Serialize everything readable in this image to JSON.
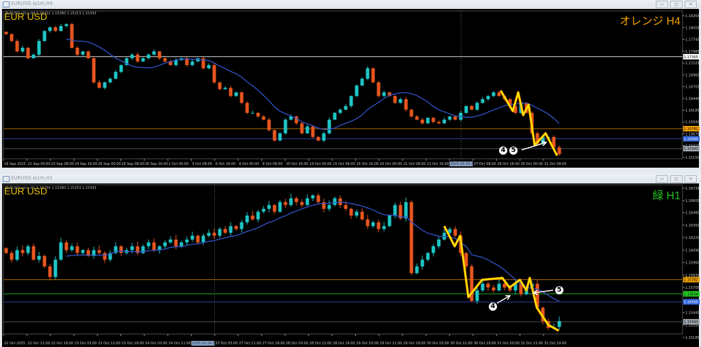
{
  "windows": [
    {
      "title": "EURUSD.oj1m,H4",
      "ohlc_header": "EURUSD.oj1m,H4  1.15301 1.15380 1.15213 1.15343",
      "symbol_label": "EUR USD",
      "timeframe_label": "オレンジ H4",
      "timeframe_color": "#f0a000"
    },
    {
      "title": "EURUSD.oj1m,H1",
      "ohlc_header": "EURUSD.oj1m,H1  1.15254 1.15380 1.15253 1.15343",
      "symbol_label": "EUR USD",
      "timeframe_label": "緑 H1",
      "timeframe_color": "#22c022"
    }
  ],
  "window_buttons": {
    "minimize": "▭",
    "restore": "◫",
    "close": "✕"
  },
  "annotations": {
    "top": [
      "4",
      "5"
    ],
    "bottom": [
      "4",
      "5"
    ]
  },
  "colors": {
    "up": "#1fc6c6",
    "down": "#e8561e",
    "ma": "#3355cc",
    "zigzag": "#ffe800"
  },
  "chart_data": [
    {
      "type": "candlestick",
      "title": "EURUSD.oj1m,H4",
      "ylim": [
        1.1515,
        1.18265
      ],
      "yticks": [
        "1.18265",
        "1.18005",
        "1.17745",
        "1.17485",
        "1.17225",
        "1.16965",
        "1.16705",
        "1.16445",
        "1.16185",
        "1.15930",
        "1.15670",
        "1.15410",
        "1.15150"
      ],
      "xticks": [
        "18 Sep 2025",
        "22 Sep 00:00",
        "23 Sep 08:00",
        "24 Sep 16:00",
        "26 Sep 00:00",
        "29 Sep 08:00",
        "30 Sep 16:00",
        "2 Oct 00:00",
        "3 Oct 08:00",
        "6 Oct 16:00",
        "8 Oct 00:00",
        "9 Oct 08:00",
        "10 Oct 16:00",
        "14 Oct 00:00",
        "15 Oct 08:00",
        "16 Oct 16:00",
        "20 Oct 00:00",
        "21 Oct 08:00",
        "22 Oct 16:00",
        "2025.10.24 23:55",
        "27 Oct 08:00",
        "28 Oct 16:00",
        "30 Oct 00:00",
        "31 Oct 08:00"
      ],
      "highlight_xtick": 19,
      "separator_tick": 19,
      "closes": [
        1.1786,
        1.1771,
        1.1748,
        1.1756,
        1.1733,
        1.1741,
        1.1771,
        1.1793,
        1.1801,
        1.1793,
        1.1804,
        1.1808,
        1.1756,
        1.1741,
        1.1748,
        1.1733,
        1.168,
        1.1668,
        1.168,
        1.1688,
        1.1703,
        1.1718,
        1.1733,
        1.1741,
        1.1726,
        1.1733,
        1.1741,
        1.1748,
        1.1733,
        1.1726,
        1.1718,
        1.1729,
        1.1733,
        1.1718,
        1.1726,
        1.1733,
        1.1711,
        1.1718,
        1.168,
        1.1665,
        1.1668,
        1.165,
        1.1658,
        1.1635,
        1.1613,
        1.1613,
        1.1605,
        1.1598,
        1.1575,
        1.1552,
        1.1568,
        1.1598,
        1.1605,
        1.159,
        1.1568,
        1.1583,
        1.156,
        1.1552,
        1.1568,
        1.1598,
        1.1613,
        1.162,
        1.1628,
        1.165,
        1.1673,
        1.1688,
        1.1711,
        1.168,
        1.165,
        1.1658,
        1.165,
        1.1635,
        1.1643,
        1.162,
        1.1605,
        1.1598,
        1.159,
        1.1602,
        1.1593,
        1.159,
        1.1598,
        1.1605,
        1.1598,
        1.1613,
        1.1628,
        1.162,
        1.1635,
        1.1643,
        1.165,
        1.1658,
        1.165,
        1.1643,
        1.1628,
        1.1613,
        1.1635,
        1.1613,
        1.1568,
        1.1545,
        1.156,
        1.156,
        1.1537,
        1.1522
      ],
      "ma_period": 12,
      "hlines": [
        {
          "price": "1.17365",
          "color": "#e0e0e0",
          "label_bg": "#ffffff",
          "label_fg": "#000000"
        },
        {
          "price": "1.15782",
          "color": "#b07000",
          "label_bg": "#f0a000",
          "label_fg": "#000000"
        },
        {
          "price": "1.15560",
          "color": "#3344aa",
          "label_bg": "#3366dd",
          "label_fg": "#ffffff"
        },
        {
          "price": "1.15343",
          "color": "#555555",
          "label_bg": "#a0a8b0",
          "label_fg": "#000000"
        }
      ],
      "zigzag": [
        [
          90.3,
          1.1662
        ],
        [
          92.5,
          1.1617
        ],
        [
          93.5,
          1.1658
        ],
        [
          94.4,
          1.1608
        ],
        [
          95.4,
          1.1631
        ],
        [
          96.5,
          1.1542
        ],
        [
          98.5,
          1.1568
        ],
        [
          100.6,
          1.1519
        ]
      ]
    },
    {
      "type": "candlestick",
      "title": "EURUSD.oj1m,H1",
      "ylim": [
        1.1518,
        1.16735
      ],
      "yticks": [
        "1.16735",
        "1.16605",
        "1.16480",
        "1.16350",
        "1.16220",
        "1.16090",
        "1.15960",
        "1.15830",
        "1.15700",
        "1.15570",
        "1.15440",
        "1.15310",
        "1.15180"
      ],
      "xticks": [
        "22 Oct 2025",
        "22 Oct 11:00",
        "22 Oct 19:00",
        "23 Oct 03:00",
        "23 Oct 11:00",
        "23 Oct 19:00",
        "24 Oct 03:00",
        "24 Oct 11:00",
        "2025.10.24 23:55",
        "27 Oct 03:00",
        "27 Oct 11:00",
        "27 Oct 19:00",
        "28 Oct 03:00",
        "28 Oct 11:00",
        "28 Oct 19:00",
        "29 Oct 03:00",
        "29 Oct 11:00",
        "29 Oct 19:00",
        "30 Oct 03:00",
        "30 Oct 11:00",
        "30 Oct 19:00",
        "31 Oct 03:00",
        "31 Oct 11:00",
        "31 Oct 19:00"
      ],
      "highlight_xtick": 8,
      "separator_tick": 8.5,
      "closes": [
        1.1606,
        1.1599,
        1.1609,
        1.1606,
        1.1613,
        1.1599,
        1.1603,
        1.1592,
        1.1581,
        1.1599,
        1.1617,
        1.1609,
        1.1613,
        1.1606,
        1.1609,
        1.1603,
        1.1609,
        1.1606,
        1.1599,
        1.1606,
        1.1613,
        1.1606,
        1.1609,
        1.1613,
        1.1606,
        1.1613,
        1.1617,
        1.1609,
        1.1613,
        1.1617,
        1.162,
        1.1613,
        1.1617,
        1.162,
        1.1624,
        1.1617,
        1.1624,
        1.1627,
        1.1624,
        1.1631,
        1.1627,
        1.1634,
        1.1631,
        1.1638,
        1.1645,
        1.1641,
        1.1649,
        1.1652,
        1.1656,
        1.1649,
        1.1659,
        1.1656,
        1.1663,
        1.1659,
        1.1656,
        1.1663,
        1.1666,
        1.1659,
        1.1652,
        1.1656,
        1.1663,
        1.1656,
        1.1652,
        1.1645,
        1.1649,
        1.1641,
        1.1634,
        1.1638,
        1.1631,
        1.1634,
        1.1645,
        1.1656,
        1.1642,
        1.1659,
        1.1585,
        1.1592,
        1.1599,
        1.1606,
        1.1613,
        1.162,
        1.1627,
        1.1631,
        1.1624,
        1.1606,
        1.1592,
        1.1556,
        1.1567,
        1.1574,
        1.157,
        1.1567,
        1.1574,
        1.157,
        1.1567,
        1.1574,
        1.1563,
        1.157,
        1.1574,
        1.1549,
        1.1535,
        1.1528,
        1.1529,
        1.1535
      ],
      "ma_period": 12,
      "hlines": [
        {
          "price": "1.15782",
          "color": "#b07000",
          "label_bg": "#f0a000",
          "label_fg": "#000000"
        },
        {
          "price": "1.15634",
          "color": "#22aa22",
          "label_bg": "#22cc22",
          "label_fg": "#000000"
        },
        {
          "price": "1.15550",
          "color": "#3344aa",
          "label_bg": "#3366dd",
          "label_fg": "#ffffff"
        },
        {
          "price": "1.15343",
          "color": "#555555",
          "label_bg": "#a0a8b0",
          "label_fg": "#000000"
        }
      ],
      "zigzag": [
        [
          80,
          1.1634
        ],
        [
          81.9,
          1.1613
        ],
        [
          82.9,
          1.1624
        ],
        [
          84.4,
          1.156
        ],
        [
          86.9,
          1.1578
        ],
        [
          90.6,
          1.158
        ],
        [
          91.9,
          1.157
        ],
        [
          93.8,
          1.1578
        ],
        [
          95,
          1.1567
        ],
        [
          95.6,
          1.158
        ],
        [
          96.9,
          1.1549
        ],
        [
          99,
          1.1531
        ],
        [
          100.9,
          1.1525
        ]
      ]
    }
  ]
}
